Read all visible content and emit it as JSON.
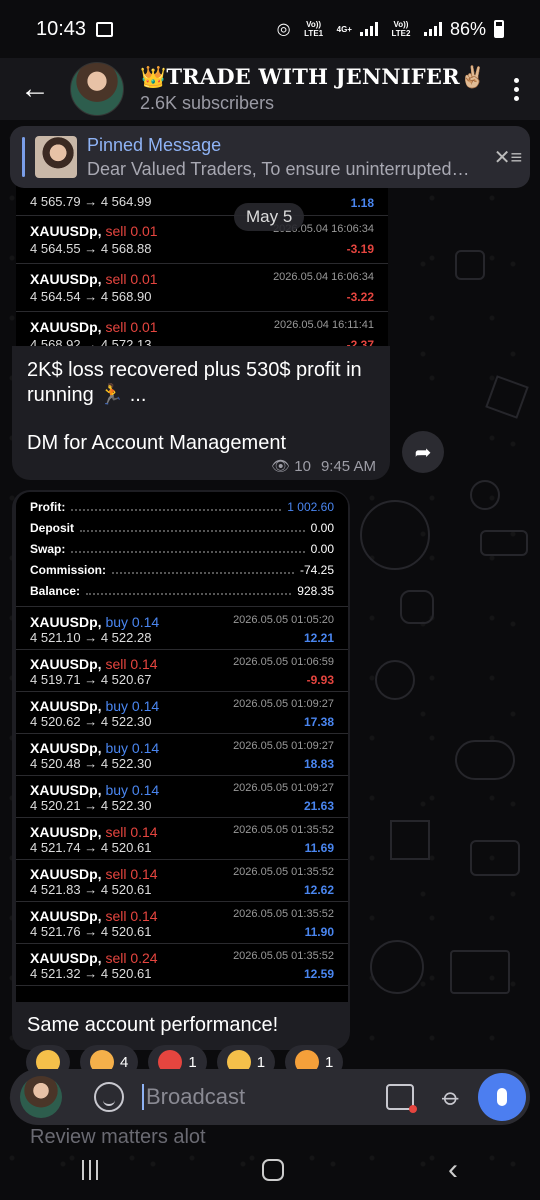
{
  "status": {
    "time": "10:43",
    "battery": "86%",
    "net1": "Vo)) LTE1",
    "net2": "4G+",
    "net3": "Vo)) LTE2"
  },
  "header": {
    "title": "👑TRADE WITH JENNIFER✌🏼",
    "subtitle": "2.6K subscribers"
  },
  "pinned": {
    "title": "Pinned Message",
    "text": "Dear Valued Traders, To ensure uninterrupted…"
  },
  "date_chip": "May 5",
  "trades_top": [
    {
      "symbol": "",
      "side": "",
      "price": "4 565.79 → 4 564.99",
      "date": "",
      "pl": "1.18",
      "pl_class": "pos"
    },
    {
      "symbol": "XAUUSDp,",
      "side": "sell 0.01",
      "price": "4 564.55 → 4 568.88",
      "date": "2026.05.04 16:06:34",
      "pl": "-3.19",
      "pl_class": "neg"
    },
    {
      "symbol": "XAUUSDp,",
      "side": "sell 0.01",
      "price": "4 564.54 → 4 568.90",
      "date": "2026.05.04 16:06:34",
      "pl": "-3.22",
      "pl_class": "neg"
    },
    {
      "symbol": "XAUUSDp,",
      "side": "sell 0.01",
      "price": "4 568.92 → 4 572.13",
      "date": "2026.05.04 16:11:41",
      "pl": "-2.37",
      "pl_class": "neg"
    }
  ],
  "msg1": {
    "line1": "2K$ loss recovered plus 530$ profit in",
    "line2": "running 🏃 ...",
    "line3": "DM for Account Management",
    "views": "10",
    "time": "9:45 AM"
  },
  "summary": [
    {
      "k": "Profit:",
      "v": "1 002.60"
    },
    {
      "k": "Deposit",
      "v": "0.00"
    },
    {
      "k": "Swap:",
      "v": "0.00"
    },
    {
      "k": "Commission:",
      "v": "-74.25"
    },
    {
      "k": "Balance:",
      "v": "928.35"
    }
  ],
  "trades": [
    {
      "symbol": "XAUUSDp,",
      "side": "buy 0.14",
      "side_class": "buy",
      "price": "4 521.10 → 4 522.28",
      "date": "2026.05.05 01:05:20",
      "pl": "12.21",
      "pl_class": "pos"
    },
    {
      "symbol": "XAUUSDp,",
      "side": "sell 0.14",
      "side_class": "sell",
      "price": "4 519.71 → 4 520.67",
      "date": "2026.05.05 01:06:59",
      "pl": "-9.93",
      "pl_class": "neg"
    },
    {
      "symbol": "XAUUSDp,",
      "side": "buy 0.14",
      "side_class": "buy",
      "price": "4 520.62 → 4 522.30",
      "date": "2026.05.05 01:09:27",
      "pl": "17.38",
      "pl_class": "pos"
    },
    {
      "symbol": "XAUUSDp,",
      "side": "buy 0.14",
      "side_class": "buy",
      "price": "4 520.48 → 4 522.30",
      "date": "2026.05.05 01:09:27",
      "pl": "18.83",
      "pl_class": "pos"
    },
    {
      "symbol": "XAUUSDp,",
      "side": "buy 0.14",
      "side_class": "buy",
      "price": "4 520.21 → 4 522.30",
      "date": "2026.05.05 01:09:27",
      "pl": "21.63",
      "pl_class": "pos"
    },
    {
      "symbol": "XAUUSDp,",
      "side": "sell 0.14",
      "side_class": "sell",
      "price": "4 521.74 → 4 520.61",
      "date": "2026.05.05 01:35:52",
      "pl": "11.69",
      "pl_class": "pos"
    },
    {
      "symbol": "XAUUSDp,",
      "side": "sell 0.14",
      "side_class": "sell",
      "price": "4 521.83 → 4 520.61",
      "date": "2026.05.05 01:35:52",
      "pl": "12.62",
      "pl_class": "pos"
    },
    {
      "symbol": "XAUUSDp,",
      "side": "sell 0.14",
      "side_class": "sell",
      "price": "4 521.76 → 4 520.61",
      "date": "2026.05.05 01:35:52",
      "pl": "11.90",
      "pl_class": "pos"
    },
    {
      "symbol": "XAUUSDp,",
      "side": "sell 0.24",
      "side_class": "sell",
      "price": "4 521.32 → 4 520.61",
      "date": "2026.05.05 01:35:52",
      "pl": "12.59",
      "pl_class": "pos"
    }
  ],
  "msg2": {
    "text": "Same account performance!"
  },
  "reactions": [
    {
      "emoji": "star",
      "count": "",
      "color": "#f5c04a"
    },
    {
      "emoji": "hearts-face",
      "count": "4",
      "color": "#f5b04a"
    },
    {
      "emoji": "heart-fire",
      "count": "1",
      "color": "#e5453f"
    },
    {
      "emoji": "thumbs-up",
      "count": "1",
      "color": "#f5c04a"
    },
    {
      "emoji": "heart-eyes",
      "count": "1",
      "color": "#f5a03a"
    }
  ],
  "input": {
    "placeholder": "Broadcast"
  },
  "ghost_text": "Review matters alot"
}
